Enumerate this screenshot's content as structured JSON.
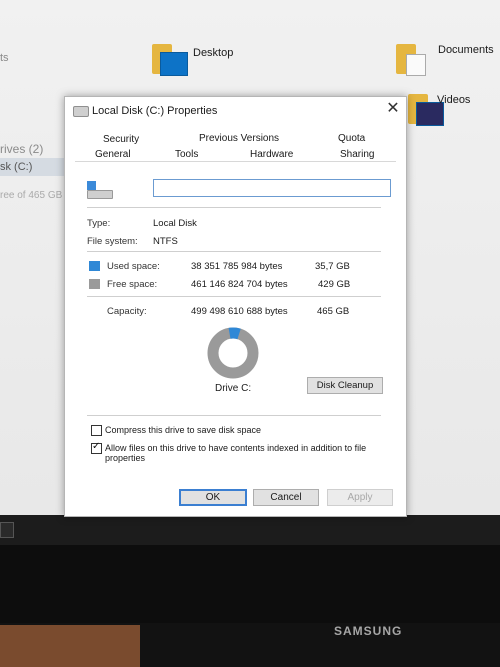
{
  "explorer": {
    "left_fragments": [
      "ts",
      "rives (2)",
      "sk (C:)",
      "ree of 465 GB"
    ],
    "folders": [
      {
        "label": "Desktop",
        "icon": "folder-desktop-icon"
      },
      {
        "label": "Documents",
        "icon": "folder-documents-icon"
      },
      {
        "label": "Videos",
        "icon": "folder-videos-icon"
      }
    ]
  },
  "dialog": {
    "title": "Local Disk (C:) Properties",
    "close_glyph": "✕",
    "tabs_row1": [
      "Security",
      "Previous Versions",
      "Quota"
    ],
    "tabs_row2": [
      "General",
      "Tools",
      "Hardware",
      "Sharing"
    ],
    "active_tab": "General",
    "name_value": "",
    "type_label": "Type:",
    "type_value": "Local Disk",
    "fs_label": "File system:",
    "fs_value": "NTFS",
    "used_label": "Used space:",
    "used_bytes": "38 351 785 984 bytes",
    "used_gb": "35,7 GB",
    "free_label": "Free space:",
    "free_bytes": "461 146 824 704 bytes",
    "free_gb": "429 GB",
    "capacity_label": "Capacity:",
    "capacity_bytes": "499 498 610 688 bytes",
    "capacity_gb": "465 GB",
    "used_fraction": 0.077,
    "drive_label": "Drive C:",
    "cleanup_label": "Disk Cleanup",
    "compress_label": "Compress this drive to save disk space",
    "compress_checked": false,
    "index_label": "Allow files on this drive to have contents indexed in addition to file properties",
    "index_checked": true,
    "ok_label": "OK",
    "cancel_label": "Cancel",
    "apply_label": "Apply",
    "colors": {
      "used": "#2f88d6",
      "free": "#9a9a9a"
    }
  },
  "monitor": {
    "brand": "SAMSUNG"
  }
}
